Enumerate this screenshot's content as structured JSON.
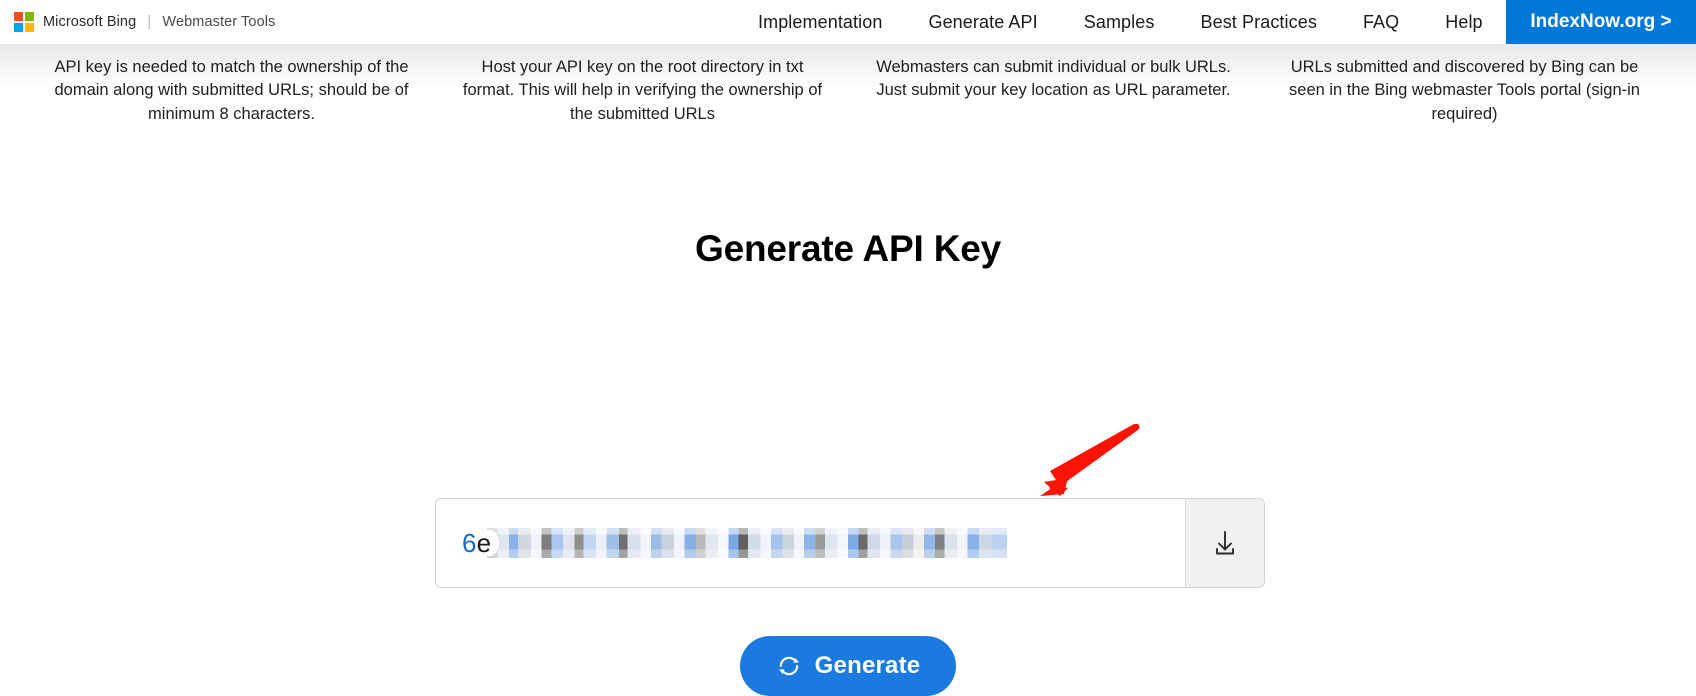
{
  "topbar": {
    "logo_icon": "microsoft-squares-logo",
    "brand": "Microsoft Bing",
    "brand_separator": "|",
    "brand_sub": "Webmaster Tools",
    "nav": [
      {
        "label": "Implementation"
      },
      {
        "label": "Generate API"
      },
      {
        "label": "Samples"
      },
      {
        "label": "Best Practices"
      },
      {
        "label": "FAQ"
      },
      {
        "label": "Help"
      }
    ],
    "cta": {
      "label": "IndexNow.org >",
      "color": "#0078d7"
    }
  },
  "info_columns": [
    {
      "text": "API key is needed to match the ownership of the domain along with submitted URLs; should be of minimum 8 characters."
    },
    {
      "text": "Host your API key on the root directory in txt format. This will help in verifying the ownership of the submitted URLs"
    },
    {
      "text": "Webmasters can submit individual or bulk URLs. Just submit your key location as URL parameter."
    },
    {
      "text": "URLs submitted and discovered by Bing can be seen in the Bing webmaster Tools portal (sign-in required)"
    }
  ],
  "main": {
    "title": "Generate API Key",
    "api_key": {
      "visible_prefix_blue": "6",
      "visible_prefix_dark": "e",
      "redacted_note": "remainder of key is pixelated / redacted",
      "download_icon": "download-icon"
    },
    "generate_button": {
      "label": "Generate",
      "icon": "refresh-icon",
      "color": "#1a7ae0"
    },
    "annotation": {
      "type": "red-arrow",
      "color": "#fb1405",
      "points_to": "api-key-field"
    }
  }
}
